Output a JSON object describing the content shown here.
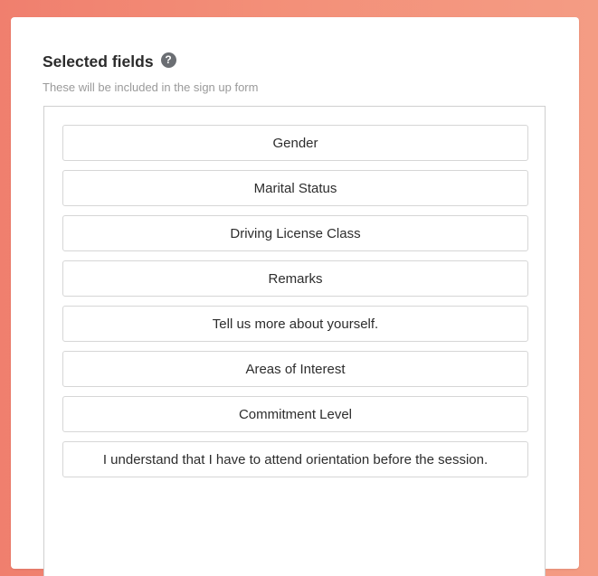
{
  "section": {
    "title": "Selected fields",
    "help_icon": "help-circle-icon",
    "help_glyph": "?",
    "subtitle": "These will be included in the sign up form"
  },
  "fields": [
    {
      "label": "Gender"
    },
    {
      "label": "Marital Status"
    },
    {
      "label": "Driving License Class"
    },
    {
      "label": "Remarks"
    },
    {
      "label": "Tell us more about yourself."
    },
    {
      "label": "Areas of Interest"
    },
    {
      "label": "Commitment Level"
    },
    {
      "label": "I understand that I have to attend orientation before the session."
    }
  ],
  "colors": {
    "background_start": "#f07f6e",
    "background_end": "#f49c84",
    "card": "#ffffff",
    "field_border": "#d6d6d6",
    "help_icon": "#6b6e73"
  }
}
